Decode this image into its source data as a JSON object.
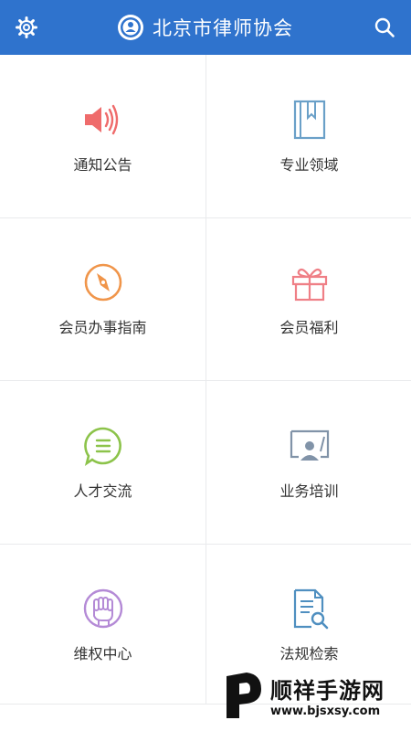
{
  "header": {
    "title": "北京市律师协会",
    "settings_icon": "gear-icon",
    "search_icon": "search-icon",
    "color": "#2f73cd"
  },
  "menu": [
    {
      "label": "通知公告",
      "icon": "megaphone-icon",
      "color": "#ef6b6b"
    },
    {
      "label": "专业领域",
      "icon": "book-icon",
      "color": "#6aa0c8"
    },
    {
      "label": "会员办事指南",
      "icon": "compass-icon",
      "color": "#f0954a"
    },
    {
      "label": "会员福利",
      "icon": "gift-icon",
      "color": "#ef7f86"
    },
    {
      "label": "人才交流",
      "icon": "chat-icon",
      "color": "#8cc34a"
    },
    {
      "label": "业务培训",
      "icon": "presentation-icon",
      "color": "#8193a8"
    },
    {
      "label": "维权中心",
      "icon": "fist-icon",
      "color": "#b48ad6"
    },
    {
      "label": "法规检索",
      "icon": "document-search-icon",
      "color": "#4f8fc0"
    }
  ],
  "watermark": {
    "name": "顺祥手游网",
    "url": "www.bjsxsy.com"
  }
}
